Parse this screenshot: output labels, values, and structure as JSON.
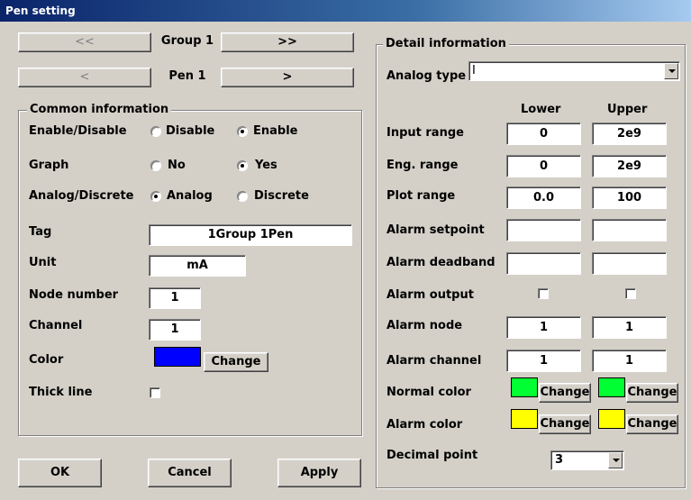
{
  "window": {
    "title": "Pen setting"
  },
  "nav": {
    "prev_group": "<<",
    "group_label": "Group 1",
    "next_group": ">>",
    "prev_pen": "<",
    "pen_label": "Pen 1",
    "next_pen": ">"
  },
  "common": {
    "legend": "Common information",
    "enable_label": "Enable/Disable",
    "disable_opt": "Disable",
    "enable_opt": "Enable",
    "enable_selected": "Enable",
    "graph_label": "Graph",
    "no_opt": "No",
    "yes_opt": "Yes",
    "graph_selected": "Yes",
    "ad_label": "Analog/Discrete",
    "analog_opt": "Analog",
    "discrete_opt": "Discrete",
    "ad_selected": "Analog",
    "tag_label": "Tag",
    "tag_value": "1Group 1Pen",
    "unit_label": "Unit",
    "unit_value": "mA",
    "node_label": "Node number",
    "node_value": "1",
    "channel_label": "Channel",
    "channel_value": "1",
    "color_label": "Color",
    "color_value": "#0000ff",
    "change": "Change",
    "thick_label": "Thick line",
    "thick_checked": false
  },
  "buttons": {
    "ok": "OK",
    "cancel": "Cancel",
    "apply": "Apply"
  },
  "detail": {
    "legend": "Detail information",
    "analog_type_label": "Analog type",
    "analog_type_value": "I",
    "lower": "Lower",
    "upper": "Upper",
    "rows": {
      "input_range": {
        "label": "Input range",
        "lower": "0",
        "upper": "2e9"
      },
      "eng_range": {
        "label": "Eng. range",
        "lower": "0",
        "upper": "2e9"
      },
      "plot_range": {
        "label": "Plot range",
        "lower": "0.0",
        "upper": "100"
      },
      "alarm_setpoint": {
        "label": "Alarm setpoint",
        "lower": "",
        "upper": ""
      },
      "alarm_deadband": {
        "label": "Alarm deadband",
        "lower": "",
        "upper": ""
      },
      "alarm_output": {
        "label": "Alarm output",
        "lower_checked": false,
        "upper_checked": false
      },
      "alarm_node": {
        "label": "Alarm node",
        "lower": "1",
        "upper": "1"
      },
      "alarm_channel": {
        "label": "Alarm channel",
        "lower": "1",
        "upper": "1"
      }
    },
    "normal_color_label": "Normal color",
    "normal_color": "#00ff33",
    "alarm_color_label": "Alarm color",
    "alarm_color": "#ffff00",
    "change": "Change",
    "decimal_label": "Decimal point",
    "decimal_value": "3"
  }
}
